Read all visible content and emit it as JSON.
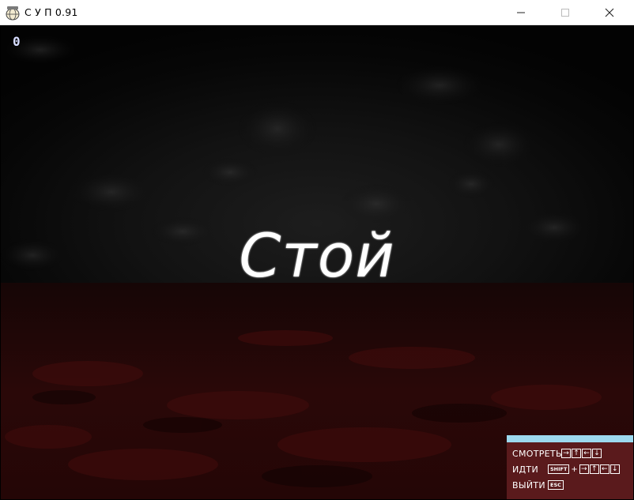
{
  "window": {
    "title": "С У П 0.91",
    "icon": "globe-app-icon",
    "buttons": {
      "minimize": "—",
      "maximize": "☐",
      "close": "✕"
    }
  },
  "game": {
    "counter": "0",
    "message": "Стой"
  },
  "controls": {
    "look": {
      "label": "СМОТРЕТЬ",
      "keys": [
        "→",
        "↑",
        "←",
        "↓"
      ]
    },
    "walk": {
      "label": "ИДТИ",
      "modifier": "SHIFT",
      "plus": "+",
      "keys": [
        "→",
        "↑",
        "←",
        "↓"
      ]
    },
    "exit": {
      "label": "ВЫЙТИ",
      "key": "ESC"
    }
  },
  "colors": {
    "panel_bg": "#5a1a1c",
    "panel_bar": "#9cd9ef",
    "counter": "#d6dcff",
    "floor": "#2a0707"
  }
}
